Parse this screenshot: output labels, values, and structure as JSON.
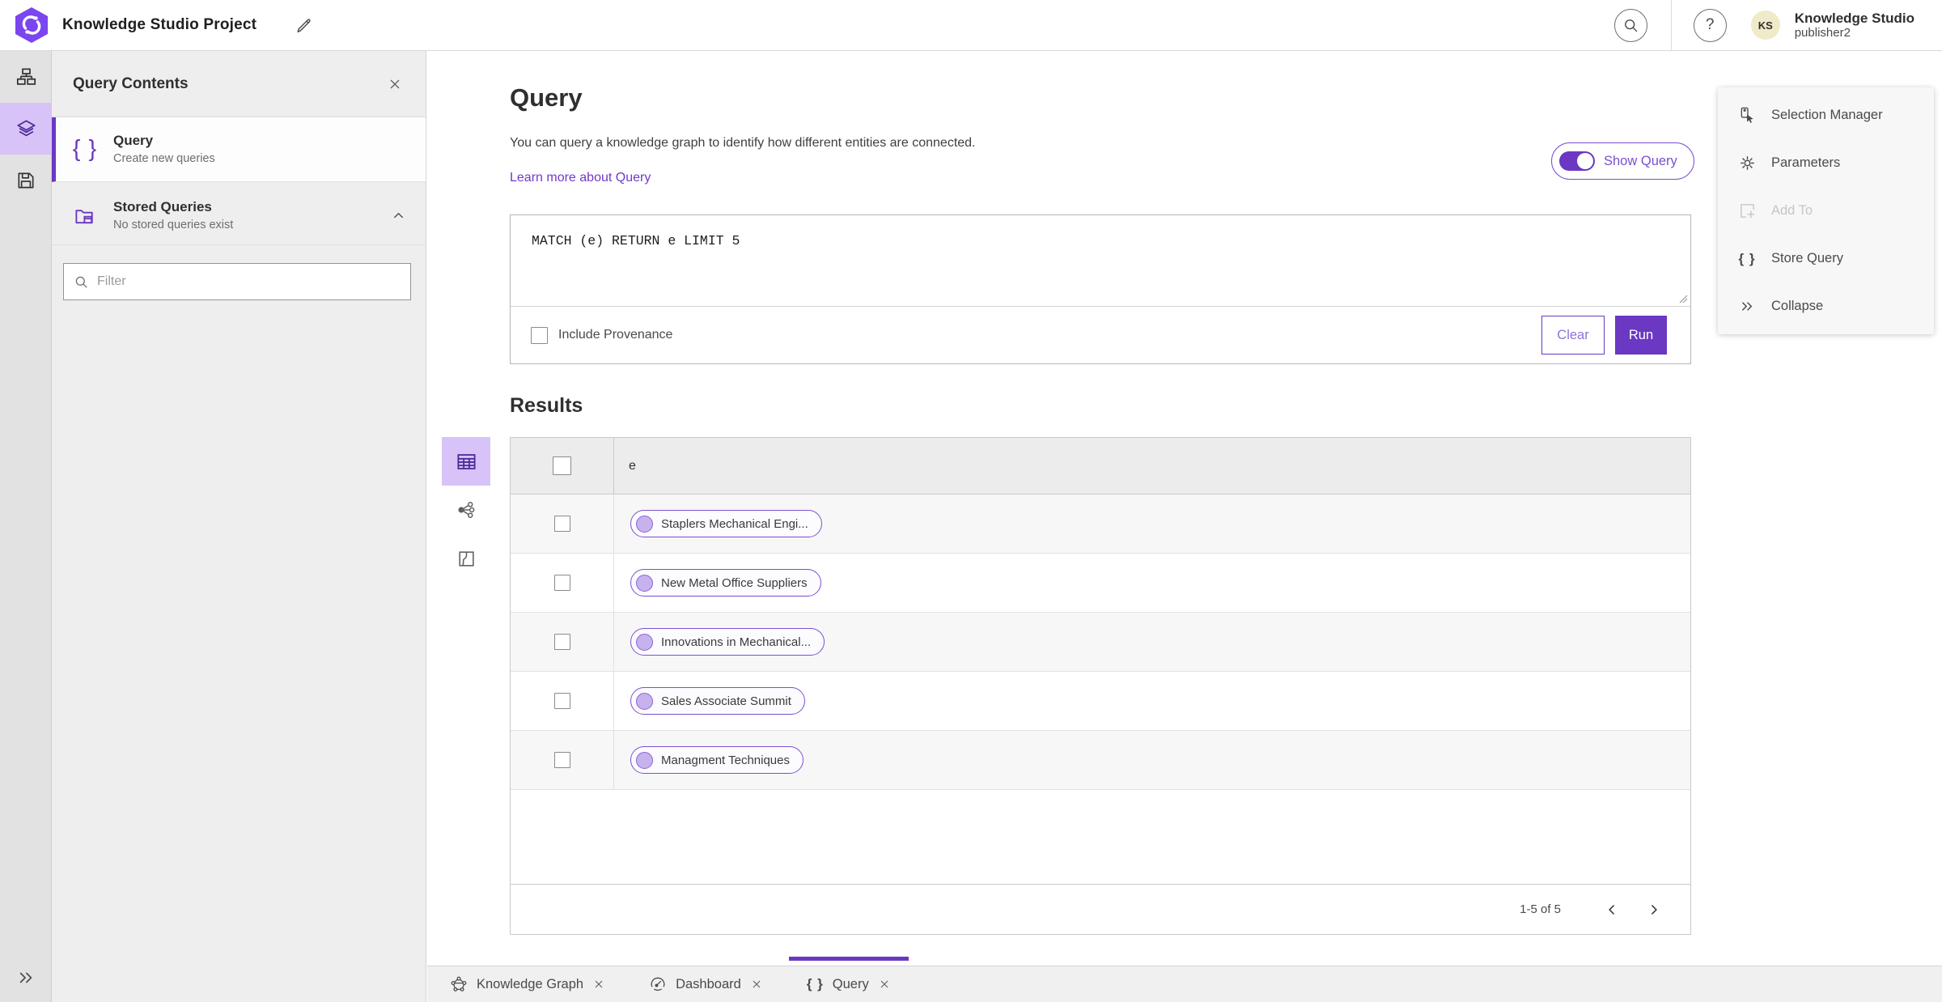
{
  "colors": {
    "accent": "#6a38c2",
    "accent_light": "#d7c3f7",
    "link": "#7239cc",
    "logo": "#7b45f0",
    "avatar_bg": "#efeac8"
  },
  "header": {
    "title": "Knowledge Studio Project",
    "avatar_initials": "KS",
    "user_name": "Knowledge Studio",
    "user_role": "publisher2"
  },
  "contents_panel": {
    "title": "Query Contents",
    "query_item": {
      "label": "Query",
      "description": "Create new queries"
    },
    "stored_item": {
      "label": "Stored Queries",
      "description": "No stored queries exist"
    },
    "filter_placeholder": "Filter"
  },
  "query": {
    "heading": "Query",
    "description": "You can query a knowledge graph to identify how different entities are connected.",
    "learn_more": "Learn more about Query",
    "show_query_label": "Show Query",
    "text": "MATCH (e) RETURN e LIMIT 5",
    "include_provenance": "Include Provenance",
    "clear": "Clear",
    "run": "Run"
  },
  "results": {
    "heading": "Results",
    "column": "e",
    "rows": [
      "Staplers Mechanical Engi...",
      "New Metal Office Suppliers",
      "Innovations in Mechanical...",
      "Sales Associate Summit",
      "Managment Techniques"
    ],
    "pagination": "1-5 of 5"
  },
  "context_menu": {
    "items": [
      {
        "label": "Selection Manager"
      },
      {
        "label": "Parameters"
      },
      {
        "label": "Add To"
      },
      {
        "label": "Store Query"
      },
      {
        "label": "Collapse"
      }
    ]
  },
  "tabs": [
    {
      "label": "Knowledge Graph"
    },
    {
      "label": "Dashboard"
    },
    {
      "label": "Query"
    }
  ]
}
